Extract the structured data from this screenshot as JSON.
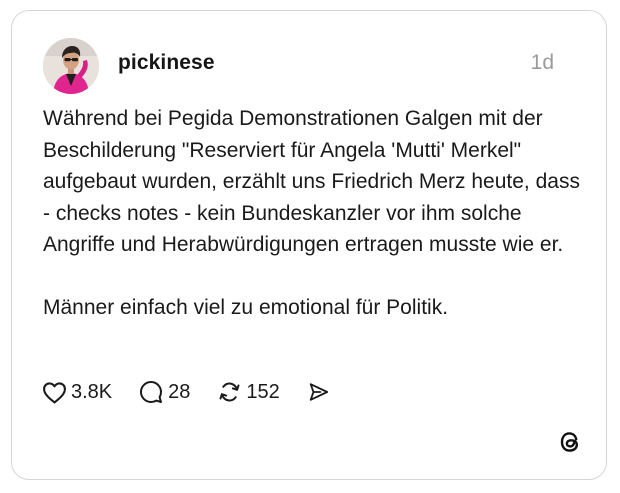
{
  "post": {
    "author": {
      "username": "pickinese",
      "avatar_icon": "profile-photo"
    },
    "time_ago": "1d",
    "paragraphs": [
      "Während bei Pegida Demonstrationen Galgen mit der Beschilderung \"Reserviert für Angela 'Mutti' Merkel\" aufgebaut wurden, erzählt uns Friedrich Merz heute, dass - checks notes - kein Bundeskanzler vor ihm solche Angriffe und Herabwürdigungen ertragen musste wie er.",
      "Männer einfach viel zu emotional für Politik."
    ],
    "actions": {
      "likes": "3.8K",
      "replies": "28",
      "reposts": "152"
    },
    "icons": {
      "like": "heart-icon",
      "reply": "comment-bubble-icon",
      "repost": "repost-arrows-icon",
      "share": "send-icon",
      "brand": "threads-logo"
    }
  },
  "colors": {
    "text": "#1a1a1a",
    "muted": "#9a9a9a",
    "border": "#d6d6d6",
    "avatar_outfit": "#e0258f"
  }
}
